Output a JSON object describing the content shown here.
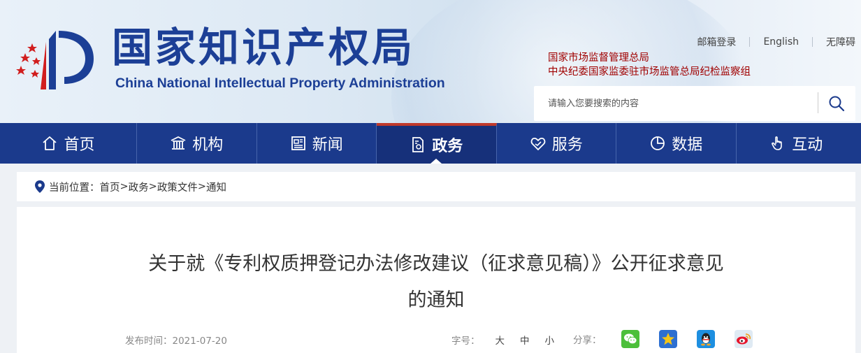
{
  "header": {
    "title_cn": "国家知识产权局",
    "title_en": "China National Intellectual Property Administration",
    "top_links": [
      "邮箱登录",
      "English",
      "无障碍"
    ],
    "affiliations": [
      "国家市场监督管理总局",
      "中央纪委国家监委驻市场监管总局纪检监察组"
    ],
    "search": {
      "placeholder": "请输入您要搜索的内容"
    }
  },
  "nav": {
    "items": [
      {
        "label": "首页",
        "icon": "home-icon"
      },
      {
        "label": "机构",
        "icon": "building-icon"
      },
      {
        "label": "新闻",
        "icon": "newspaper-icon"
      },
      {
        "label": "政务",
        "icon": "document-icon",
        "active": true
      },
      {
        "label": "服务",
        "icon": "heart-hand-icon"
      },
      {
        "label": "数据",
        "icon": "pie-chart-icon"
      },
      {
        "label": "互动",
        "icon": "pointer-hand-icon"
      }
    ]
  },
  "breadcrumb": {
    "prefix": "当前位置：",
    "trail": [
      "首页",
      "政务",
      "政策文件",
      "通知"
    ]
  },
  "article": {
    "title_line1": "关于就《专利权质押登记办法修改建议（征求意见稿）》公开征求意见",
    "title_line2": "的通知",
    "date_label": "发布时间：",
    "date": "2021-07-20",
    "font_size_label": "字号：",
    "font_sizes": [
      "大",
      "中",
      "小"
    ],
    "share_label": "分享：",
    "share_targets": [
      "wechat-icon",
      "qzone-icon",
      "qq-icon",
      "weibo-icon"
    ]
  },
  "colors": {
    "brand_blue": "#1b3a8c",
    "accent_red": "#c0392b",
    "affiliation_red": "#a00000"
  }
}
